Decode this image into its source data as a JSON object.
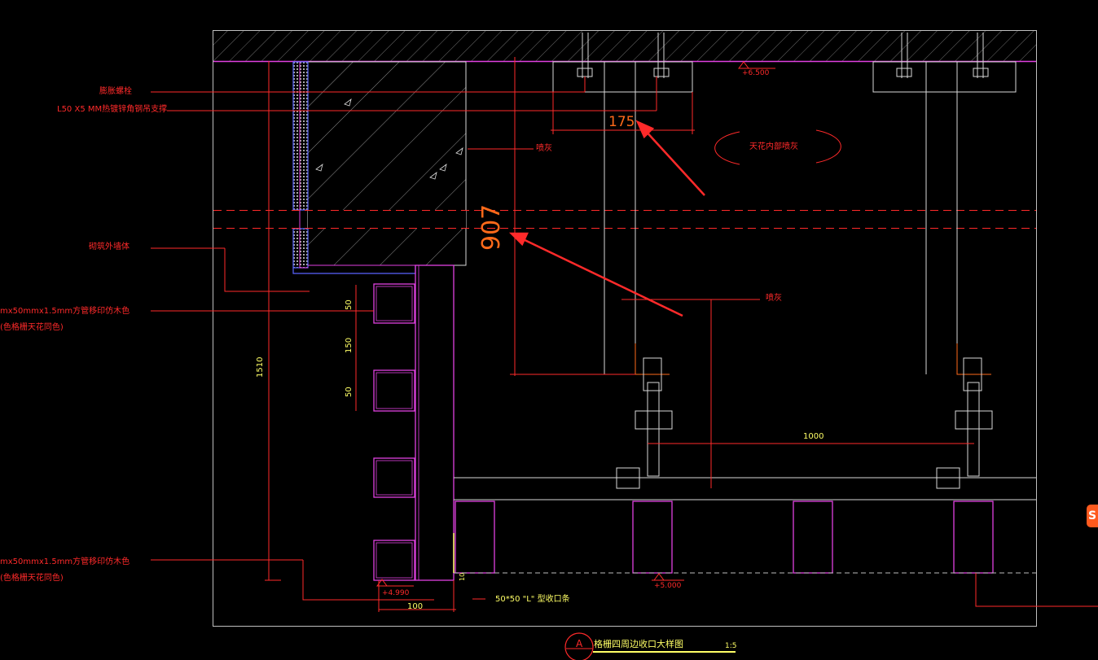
{
  "labels": {
    "anchor_bolt": "膨胀螺栓",
    "angle_steel": "L50 X5 MM热镀锌角钢吊支撑",
    "spray_left": "喷灰",
    "ceiling_spray": "天花内部喷灰",
    "partition_wall": "砌筑外墙体",
    "tube_upper_line1": "mx50mmx1.5mm方管移印仿木色",
    "tube_upper_line2": "(色格栅天花同色)",
    "spray_right": "喷灰",
    "tube_lower_line1": "mx50mmx1.5mm方管移印仿木色",
    "tube_lower_line2": "(色格栅天花同色)",
    "l_strip": "50*50 \"L\" 型收口条"
  },
  "dimensions": {
    "d175": "175",
    "d907": "907",
    "d1510": "1510",
    "d1000": "1000",
    "d50a": "50",
    "d150": "150",
    "d50b": "50",
    "d100": "100",
    "d10": "10"
  },
  "levels": {
    "top": "+6.500",
    "bottom_right": "+5.000",
    "bottom_left": "+4.990"
  },
  "title_block": {
    "symbol": "A",
    "title": "格栅四周边收口大样图",
    "scale": "1:5"
  },
  "colors": {
    "background": "#000000",
    "frame": "#bfbfbf",
    "red": "#ff2a2a",
    "magenta": "#e040e0",
    "blue": "#5a64ff",
    "white": "#ffffff",
    "yellow": "#ffff66",
    "orange": "#ff6a1a"
  },
  "badge": {
    "icon": "sogou-ime-icon",
    "text": "S"
  }
}
